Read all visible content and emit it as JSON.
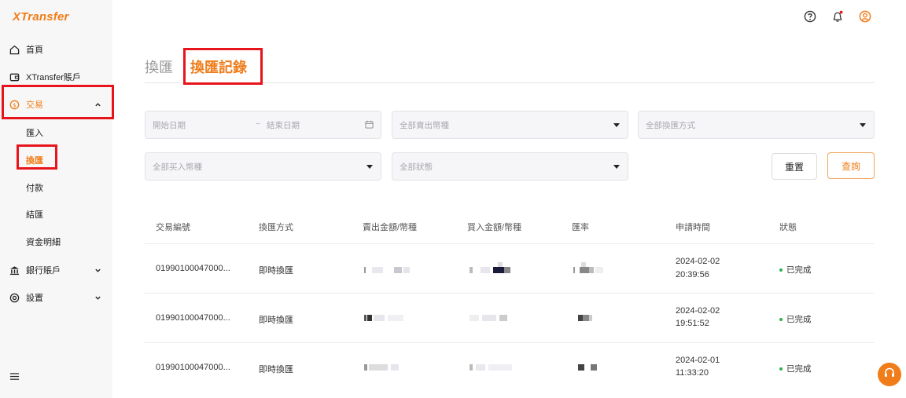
{
  "app": {
    "logo": "XTransfer"
  },
  "sidebar": {
    "home": "首頁",
    "account": "XTransfer賬戶",
    "trade": "交易",
    "trade_sub": [
      "匯入",
      "換匯",
      "付款",
      "結匯",
      "資金明細"
    ],
    "bank": "銀行賬戶",
    "settings": "設置"
  },
  "tabs": {
    "exchange": "換匯",
    "records": "換匯記錄"
  },
  "filters": {
    "start_date": "開始日期",
    "date_sep": "~",
    "end_date": "結束日期",
    "sell_currency": "全部賣出幣種",
    "exchange_method": "全部換匯方式",
    "buy_currency": "全部买入幣種",
    "status": "全部狀態",
    "reset": "重置",
    "query": "查詢"
  },
  "table": {
    "headers": [
      "交易編號",
      "換匯方式",
      "賣出金額/幣種",
      "買入金額/幣種",
      "匯率",
      "申請時間",
      "狀態"
    ],
    "rows": [
      {
        "id": "01990100047000...",
        "method": "即時換匯",
        "date": "2024-02-02",
        "time": "20:39:56",
        "status": "已完成"
      },
      {
        "id": "01990100047000...",
        "method": "即時換匯",
        "date": "2024-02-02",
        "time": "19:51:52",
        "status": "已完成"
      },
      {
        "id": "01990100047000...",
        "method": "即時換匯",
        "date": "2024-02-01",
        "time": "11:33:20",
        "status": "已完成"
      }
    ]
  },
  "colors": {
    "brand": "#f07d1a",
    "highlight": "#e8141c",
    "success": "#2bb24c"
  }
}
